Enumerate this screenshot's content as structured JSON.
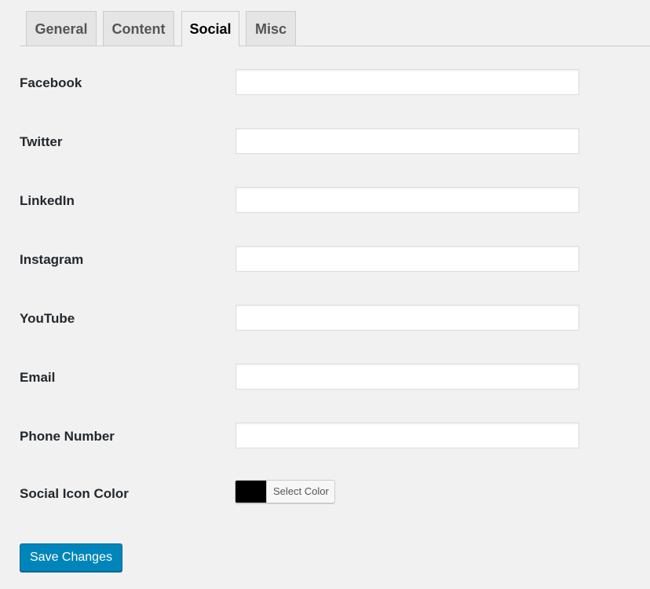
{
  "tabs": [
    {
      "label": "General",
      "active": false
    },
    {
      "label": "Content",
      "active": false
    },
    {
      "label": "Social",
      "active": true
    },
    {
      "label": "Misc",
      "active": false
    }
  ],
  "fields": {
    "facebook": {
      "label": "Facebook",
      "value": ""
    },
    "twitter": {
      "label": "Twitter",
      "value": ""
    },
    "linkedin": {
      "label": "LinkedIn",
      "value": ""
    },
    "instagram": {
      "label": "Instagram",
      "value": ""
    },
    "youtube": {
      "label": "YouTube",
      "value": ""
    },
    "email": {
      "label": "Email",
      "value": ""
    },
    "phone": {
      "label": "Phone Number",
      "value": ""
    }
  },
  "social_icon_color": {
    "label": "Social Icon Color",
    "button_label": "Select Color",
    "value": "#000000"
  },
  "save_label": "Save Changes",
  "colors": {
    "background": "#f1f1f1",
    "primary_button": "#0085ba"
  }
}
